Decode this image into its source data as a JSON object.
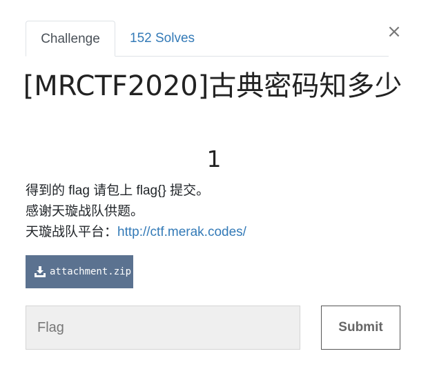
{
  "tabs": [
    {
      "label": "Challenge",
      "active": true
    },
    {
      "label": "152 Solves",
      "active": false
    }
  ],
  "close_label": "×",
  "challenge": {
    "title": "[MRCTF2020]古典密码知多少",
    "points": "1",
    "description": [
      "得到的 flag 请包上 flag{} 提交。",
      "感谢天璇战队供题。"
    ],
    "platform_prefix": "天璇战队平台：",
    "platform_link": "http://ctf.merak.codes/"
  },
  "attachment": {
    "label": "attachment.zip",
    "icon": "download-icon"
  },
  "flag_input": {
    "placeholder": "Flag",
    "value": ""
  },
  "submit_label": "Submit",
  "colors": {
    "link": "#337ab7",
    "attachment_bg": "#5b7290",
    "input_bg": "#efefef"
  }
}
